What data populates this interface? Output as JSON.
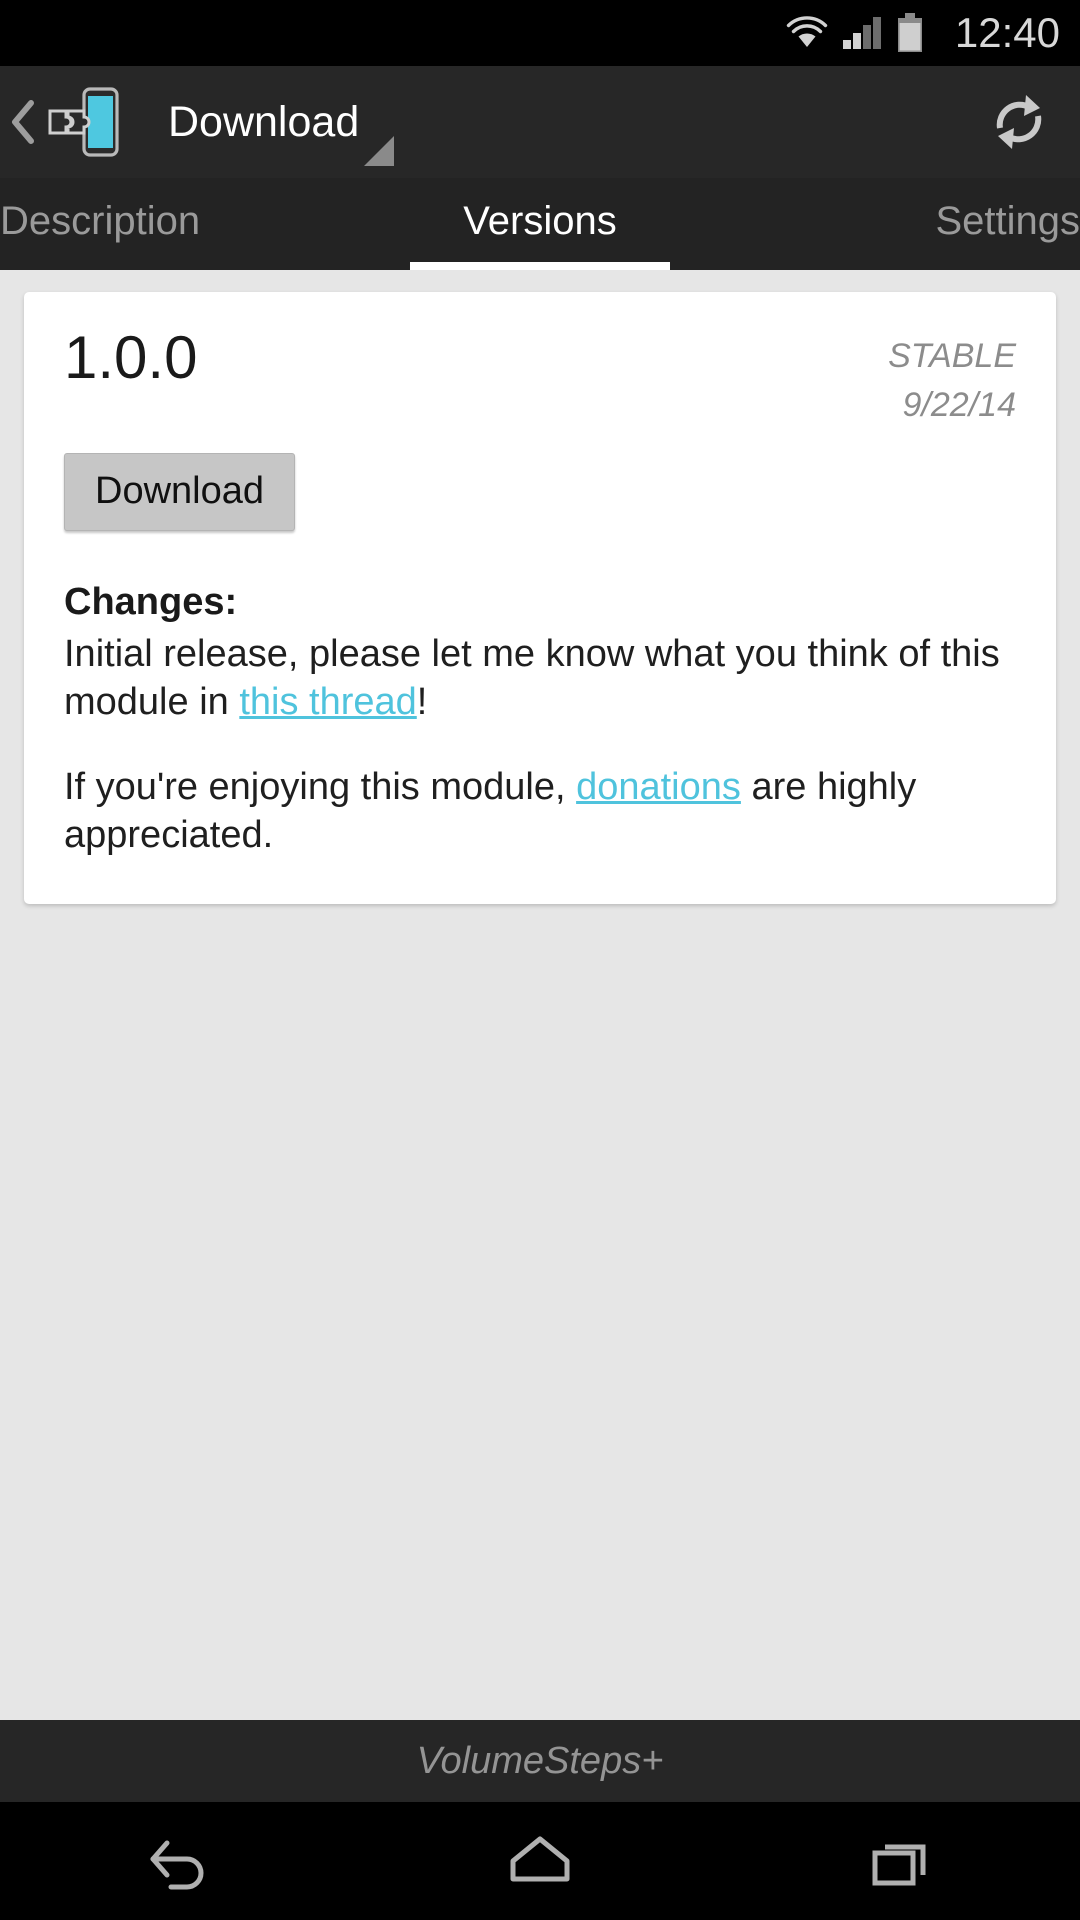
{
  "status_bar": {
    "clock": "12:40",
    "icons": [
      "wifi-icon",
      "cellular-signal-icon",
      "battery-icon"
    ],
    "wifi_level": 4,
    "signal_bars_lit": 2,
    "signal_bars_total": 4,
    "battery_level_pct": 90,
    "background_color": "#000000"
  },
  "action_bar": {
    "title": "Download",
    "app_icon": "xposed-module-icon",
    "up_icon": "back-chevron-icon",
    "spinner_icon": "dropdown-caret-icon",
    "refresh_label": "refresh-icon",
    "accent_color": "#4ec8e0",
    "background_color": "#272727"
  },
  "tabs": {
    "items": [
      {
        "label": "Description",
        "active": false
      },
      {
        "label": "Versions",
        "active": true
      },
      {
        "label": "Settings",
        "active": false
      }
    ],
    "indicator_color": "#ffffff"
  },
  "version_card": {
    "version": "1.0.0",
    "channel": "STABLE",
    "date": "9/22/14",
    "download_label": "Download",
    "changes_label": "Changes:",
    "paragraphs": [
      {
        "parts": [
          {
            "type": "text",
            "value": "Initial release, please let me know what you think of this module in "
          },
          {
            "type": "link",
            "value": "this thread"
          },
          {
            "type": "text",
            "value": "!"
          }
        ]
      },
      {
        "parts": [
          {
            "type": "text",
            "value": "If you're enjoying this module, "
          },
          {
            "type": "link",
            "value": "donations"
          },
          {
            "type": "text",
            "value": " are highly appreciated."
          }
        ]
      }
    ],
    "link_color": "#4fc3dd",
    "card_background": "#ffffff"
  },
  "footer": {
    "module_name": "VolumeSteps+"
  },
  "nav_bar": {
    "buttons": [
      {
        "name": "back-button",
        "icon": "back-arrow-icon"
      },
      {
        "name": "home-button",
        "icon": "home-icon"
      },
      {
        "name": "recents-button",
        "icon": "recents-icon"
      }
    ],
    "background_color": "#000000"
  }
}
